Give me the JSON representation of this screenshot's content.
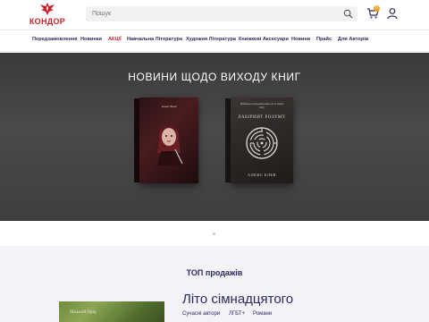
{
  "brand": {
    "name": "КОНДОР",
    "color": "#c8202f"
  },
  "search": {
    "placeholder": "Пошук"
  },
  "cart": {
    "count": "0"
  },
  "nav": {
    "items": [
      {
        "label": "Передзамовлення"
      },
      {
        "label": "Новинки"
      },
      {
        "label": "АКЦІЇ"
      },
      {
        "label": "Навчальна Література"
      },
      {
        "label": "Художня Література"
      },
      {
        "label": "Книжкові Аксесуари"
      },
      {
        "label": "Новини"
      },
      {
        "label": "Прайс"
      },
      {
        "label": "Для Авторів"
      }
    ]
  },
  "hero": {
    "title": "НОВИНИ ЩОДО ВИХОДУ КНИГ",
    "book1": {
      "author": "Алекс Блек"
    },
    "book2": {
      "top": "Найбільш моторошна книга на 14 мовах світу",
      "title": "ЛАБІРИНТ РОЗУМУ",
      "author": "АЛЕКС БЛЕК"
    }
  },
  "bestsellers": {
    "title": "ТОП продажів",
    "featured": {
      "title": "Літо сімнадцятого",
      "cover_text": "Малахій Пріц",
      "tags": [
        "Сучасні автори",
        "ЛГБТ+",
        "Романи"
      ]
    }
  },
  "colors": {
    "nav_text": "#2b2b5e",
    "sale": "#d42233",
    "badge": "#f0a020"
  },
  "icons": [
    "logo-eagle-icon",
    "search-icon",
    "cart-icon",
    "user-icon"
  ]
}
